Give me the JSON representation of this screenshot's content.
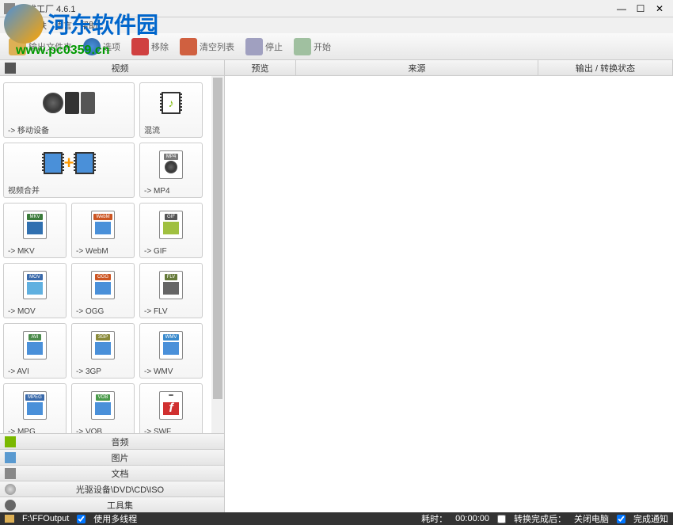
{
  "watermark": {
    "text": "河东软件园",
    "url": "www.pc0359.cn"
  },
  "window": {
    "title": "格式工厂 4.6.1"
  },
  "menu": {
    "items": [
      "任务",
      "皮肤",
      "语言",
      "帮助"
    ]
  },
  "toolbar": {
    "output_folder": "输出文件夹",
    "options": "选项",
    "remove": "移除",
    "clear_list": "清空列表",
    "stop": "停止",
    "start": "开始"
  },
  "categories": {
    "video": "视频",
    "audio": "音频",
    "image": "图片",
    "document": "文档",
    "disc": "光驱设备\\DVD\\CD\\ISO",
    "toolkit": "工具集"
  },
  "video_tiles": {
    "mobile": "-> 移动设备",
    "mux": "混流",
    "merge": "视频合并",
    "mp4": "-> MP4",
    "mkv": "-> MKV",
    "webm": "-> WebM",
    "gif": "-> GIF",
    "mov": "-> MOV",
    "ogg": "-> OGG",
    "flv": "-> FLV",
    "avi": "-> AVI",
    "3gp": "-> 3GP",
    "wmv": "-> WMV",
    "mpg": "-> MPG",
    "vob": "-> VOB",
    "swf": "-> SWF"
  },
  "badges": {
    "mp4": "MP4",
    "mkv": "MKV",
    "webm": "WebM",
    "gif": "GIF",
    "mov": "MOV",
    "ogg": "OGG",
    "flv": "FLV",
    "avi": "AVI",
    "3gp": "3GP",
    "wmv": "WMV",
    "mpg": "MPEG",
    "vob": "VOB",
    "swf": ""
  },
  "columns": {
    "preview": "预览",
    "source": "来源",
    "output_status": "输出 / 转换状态"
  },
  "statusbar": {
    "output_path": "F:\\FFOutput",
    "multithread": "使用多线程",
    "elapsed_label": "耗时：",
    "elapsed_value": "00:00:00",
    "after_done": "转换完成后：",
    "shutdown": "关闭电脑",
    "notify": "完成通知"
  },
  "badge_colors": {
    "mp4": "#7a7a7a",
    "mkv": "#3a7a3a",
    "webm": "#cc5522",
    "gif": "#555",
    "mov": "#3a6aaa",
    "ogg": "#cc5522",
    "flv": "#667a3a",
    "avi": "#4a8a4a",
    "3gp": "#8a8a3a",
    "wmv": "#3a8acc",
    "mpg": "#3a6aaa",
    "vob": "#4a9a4a"
  }
}
